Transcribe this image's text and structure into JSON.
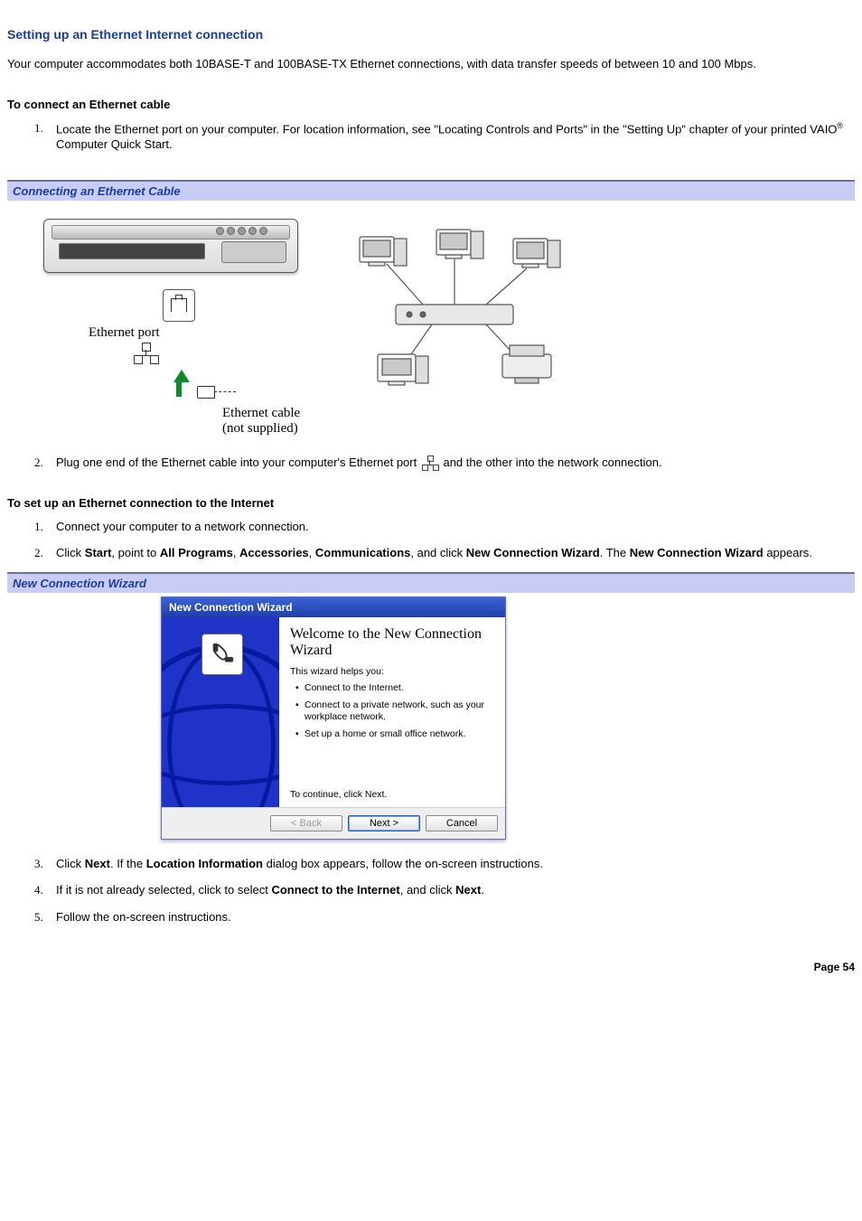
{
  "title": "Setting up an Ethernet Internet connection",
  "intro": "Your computer accommodates both 10BASE-T and 100BASE-TX Ethernet connections, with data transfer speeds of between 10 and 100 Mbps.",
  "section1_heading": "To connect an Ethernet cable",
  "section1_steps": {
    "s1a": "Locate the Ethernet port on your computer. For location information, see \"Locating Controls and Ports\" in the \"Setting Up\" chapter of your printed VAIO",
    "s1a_tail": " Computer Quick Start.",
    "s2a": "Plug one end of the Ethernet cable into your computer's Ethernet port ",
    "s2b": "and the other into the network connection."
  },
  "fig1_caption": "Connecting an Ethernet Cable",
  "fig1_labels": {
    "port": "Ethernet port",
    "cable": "Ethernet cable",
    "cable_sub": "(not supplied)"
  },
  "section2_heading": "To set up an Ethernet connection to the Internet",
  "section2_steps": {
    "s1": "Connect your computer to a network connection.",
    "s2_pre": "Click ",
    "s2_start": "Start",
    "s2_a": ", point to ",
    "s2_allprog": "All Programs",
    "s2_b": ", ",
    "s2_acc": "Accessories",
    "s2_c": ", ",
    "s2_comm": "Communications",
    "s2_d": ", and click ",
    "s2_ncw": "New Connection Wizard",
    "s2_e": ". The ",
    "s2_ncw2": "New Connection Wizard",
    "s2_f": " appears.",
    "s3_pre": "Click ",
    "s3_next": "Next",
    "s3_a": ". If the ",
    "s3_loc": "Location Information",
    "s3_b": " dialog box appears, follow the on-screen instructions.",
    "s4_a": "If it is not already selected, click to select ",
    "s4_cti": "Connect to the Internet",
    "s4_b": ", and click ",
    "s4_next": "Next",
    "s4_c": ".",
    "s5": "Follow the on-screen instructions."
  },
  "fig2_caption": "New Connection Wizard",
  "wizard": {
    "titlebar": "New Connection Wizard",
    "heading": "Welcome to the New Connection Wizard",
    "lead": "This wizard helps you:",
    "bullets": [
      "Connect to the Internet.",
      "Connect to a private network, such as your workplace network.",
      "Set up a home or small office network."
    ],
    "continue": "To continue, click Next.",
    "back": "< Back",
    "next": "Next >",
    "cancel": "Cancel"
  },
  "page_number": "Page 54",
  "reg_mark": "®"
}
